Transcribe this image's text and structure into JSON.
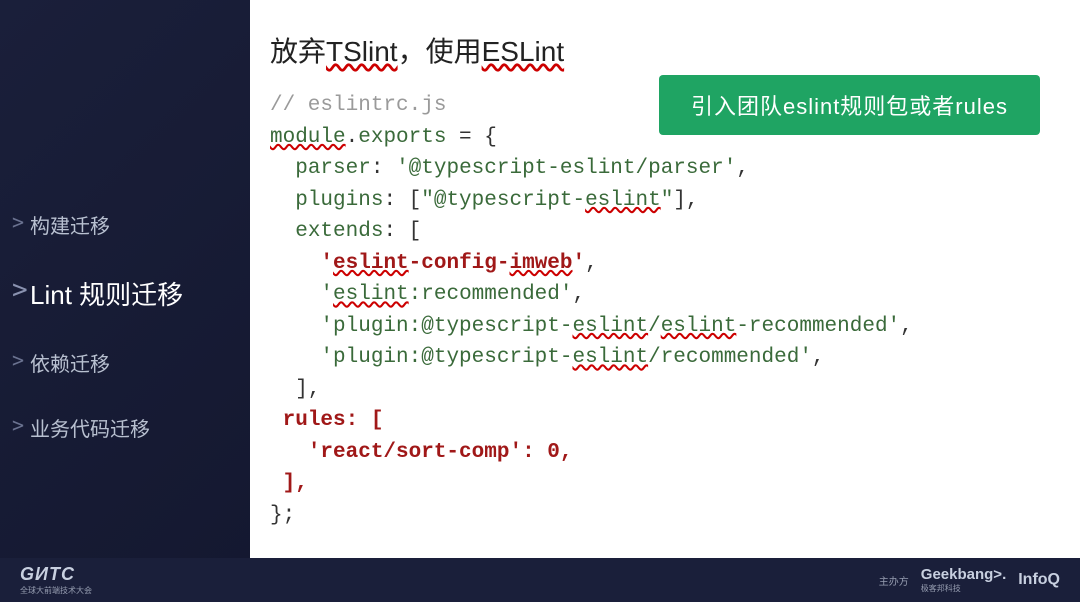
{
  "sidebar": {
    "items": [
      {
        "label": "构建迁移",
        "active": false
      },
      {
        "label": "Lint 规则迁移",
        "active": true
      },
      {
        "label": "依赖迁移",
        "active": false
      },
      {
        "label": "业务代码迁移",
        "active": false
      }
    ]
  },
  "heading": {
    "prefix": "放弃",
    "ul1": "TSlint",
    "mid": "，使用",
    "ul2": "ESLint"
  },
  "callout": "引入团队eslint规则包或者rules",
  "code": {
    "comment": "// eslintrc.js",
    "module": "module",
    "exports": "exports",
    "eq_open": " = {",
    "parser_key": "parser",
    "parser_val": "'@typescript-eslint/parser'",
    "plugins_key": "plugins",
    "plugins_val1": "\"@typescript-",
    "plugins_val_ul": "eslint",
    "plugins_val2": "\"",
    "extends_key": "extends",
    "ext1_a": "'",
    "ext1_b": "eslint",
    "ext1_c": "-config-",
    "ext1_d": "imweb",
    "ext1_e": "'",
    "ext2_a": "'",
    "ext2_b": "eslint",
    "ext2_c": ":recommended'",
    "ext3_a": "'plugin:@typescript-",
    "ext3_b": "eslint",
    "ext3_c": "/",
    "ext3_d": "eslint",
    "ext3_e": "-recommended'",
    "ext4_a": "'plugin:@typescript-",
    "ext4_b": "eslint",
    "ext4_c": "/recommended'",
    "rules_key": "rules",
    "rules_item_key": "'react/sort-comp'",
    "rules_item_val": "0"
  },
  "footer": {
    "left_main": "GИTC",
    "left_sub": "全球大前端技术大会",
    "host_label": "主办方",
    "brand1": "Geekbang>.",
    "brand1_sub": "极客邦科技",
    "brand2": "InfoQ"
  }
}
